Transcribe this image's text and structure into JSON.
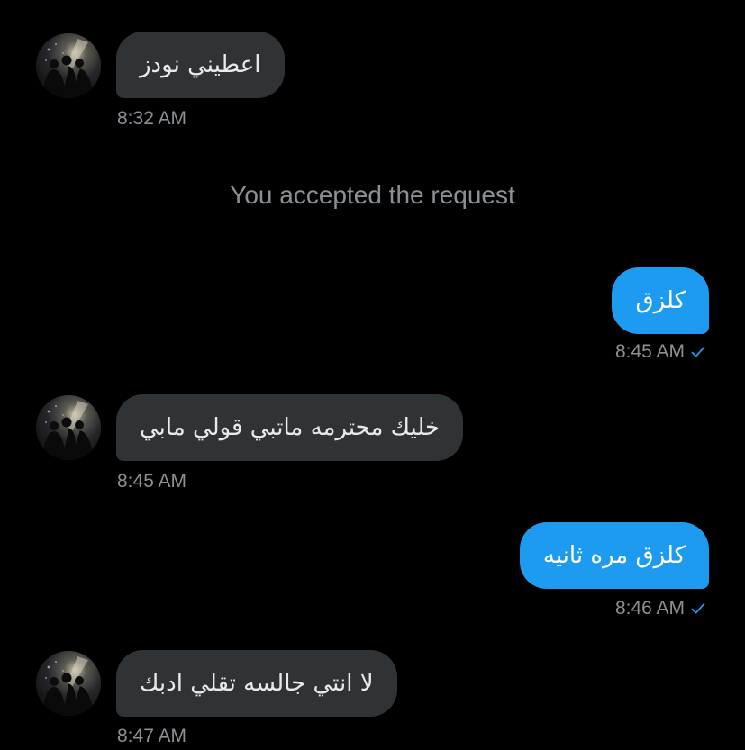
{
  "colors": {
    "background": "#000000",
    "incoming_bubble": "#2f3336",
    "outgoing_bubble": "#1d9bf0",
    "timestamp": "#8b9096",
    "read_check": "#1d9bf0"
  },
  "messages": [
    {
      "direction": "incoming",
      "text": "اعطيني نودز",
      "time": "8:32 AM"
    },
    {
      "direction": "outgoing",
      "text": "كلزق",
      "time": "8:45 AM",
      "status_icon": "check-icon"
    },
    {
      "direction": "incoming",
      "text": "خليك محترمه ماتبي قولي مابي",
      "time": "8:45 AM"
    },
    {
      "direction": "outgoing",
      "text": "كلزق مره ثانيه",
      "time": "8:46 AM",
      "status_icon": "check-icon"
    },
    {
      "direction": "incoming",
      "text": "لا انتي جالسه تقلي ادبك",
      "time": "8:47 AM"
    }
  ],
  "system_notice": "You accepted the request"
}
